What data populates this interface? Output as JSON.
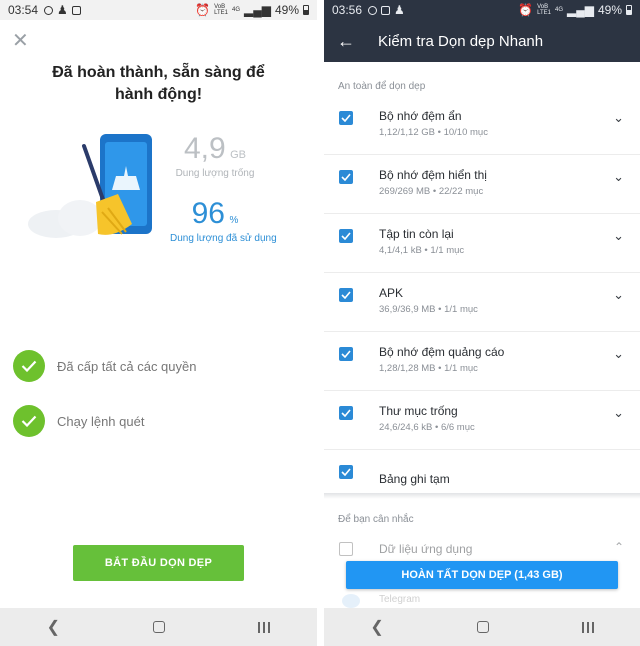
{
  "left_screen": {
    "status": {
      "time": "03:54",
      "battery": "49%",
      "net_top": "VoB",
      "net_bottom": "LTE1",
      "net_small": "4G"
    },
    "title": "Đã hoàn thành, sẵn sàng để hành động!",
    "free_space": {
      "value": "4,9",
      "unit": "GB",
      "label": "Dung lượng trống"
    },
    "used_space": {
      "value": "96",
      "unit": "%",
      "label": "Dung lượng đã sử dụng"
    },
    "steps": [
      {
        "label": "Đã cấp tất cả các quyền"
      },
      {
        "label": "Chạy lệnh quét"
      }
    ],
    "start_button": "BẮT ĐẦU DỌN DẸP"
  },
  "right_screen": {
    "status": {
      "time": "03:56",
      "battery": "49%",
      "net_top": "VoB",
      "net_bottom": "LTE1",
      "net_small": "4G"
    },
    "appbar_title": "Kiểm tra Dọn dẹp Nhanh",
    "section_safe": "An toàn để dọn dẹp",
    "items": [
      {
        "name": "Bộ nhớ đệm ẩn",
        "meta": "1,12/1,12 GB • 10/10 mục"
      },
      {
        "name": "Bộ nhớ đệm hiển thị",
        "meta": "269/269 MB • 22/22 mục"
      },
      {
        "name": "Tập tin còn lại",
        "meta": "4,1/4,1 kB • 1/1 mục"
      },
      {
        "name": "APK",
        "meta": "36,9/36,9 MB • 1/1 mục"
      },
      {
        "name": "Bộ nhớ đệm quảng cáo",
        "meta": "1,28/1,28 MB • 1/1 mục"
      },
      {
        "name": "Thư mục trống",
        "meta": "24,6/24,6 kB • 6/6 mục"
      },
      {
        "name": "Bảng ghi tạm",
        "meta": ""
      }
    ],
    "section_consider": "Để bạn cân nhắc",
    "consider_item": "Dữ liệu ứng dụng",
    "finish_button": "HOÀN TẤT DỌN DẸP (1,43 GB)",
    "ghost_item": "Telegram"
  },
  "colors": {
    "accent_green": "#66c03a",
    "accent_blue": "#2196f3",
    "appbar": "#2c3442"
  }
}
